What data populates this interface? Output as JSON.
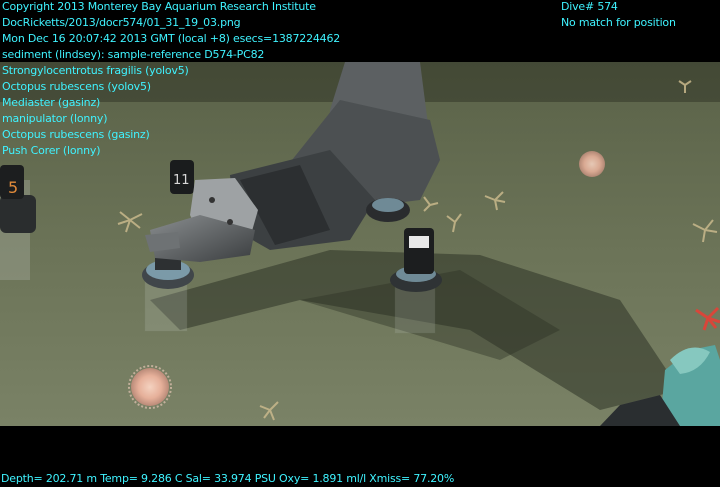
{
  "overlay_left": [
    "Copyright 2013 Monterey Bay Aquarium Research Institute",
    "DocRicketts/2013/docr574/01_31_19_03.png",
    "Mon Dec 16 20:07:42 2013 GMT (local +8)  esecs=1387224462",
    "sediment (lindsey): sample-reference D574-PC82",
    "Strongylocentrotus fragilis (yolov5)",
    "Octopus rubescens (yolov5)",
    "Mediaster (gasinz)",
    "manipulator (lonny)",
    "Octopus rubescens (gasinz)",
    "Push Corer (lonny)"
  ],
  "overlay_right": [
    "Dive# 574",
    "No match for position"
  ],
  "telemetry": "Depth= 202.71 m  Temp= 9.286 C  Sal= 33.974 PSU  Oxy= 1.891 ml/l  Xmiss= 77.20%",
  "core_labels": {
    "left": "5",
    "middle": "11"
  },
  "colors": {
    "overlay_text": "#3ff3ff",
    "seafloor": "#6f7758",
    "frame": "#000000"
  }
}
